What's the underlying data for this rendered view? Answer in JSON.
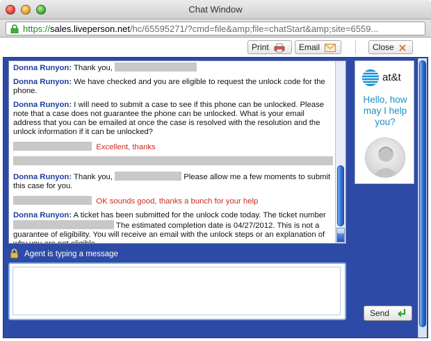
{
  "window": {
    "title": "Chat Window",
    "url_scheme": "https://",
    "url_host": "sales.liveperson.net",
    "url_rest": "/hc/65595271/?cmd=file&amp;file=chatStart&amp;site=6559..."
  },
  "toolbar": {
    "print_label": "Print",
    "email_label": "Email",
    "close_label": "Close"
  },
  "transcript": {
    "speaker": "Donna Runyon:",
    "messages": [
      {
        "text": " Thank you, "
      },
      {
        "text": " We have checked and you are eligible to request the unlock code for the phone."
      },
      {
        "text": " I will need to submit a case to see if this phone can be unlocked.  Please note that a case does not guarantee the phone can be unlocked.  What is your email address that you can be emailed at once the case is resolved with the resolution and the unlock information if it can be unlocked?"
      },
      {
        "text": "Excellent, thanks"
      },
      {
        "pre": " Thank you, ",
        "post": "  Please allow me a few moments to submit this case for you."
      },
      {
        "text": "OK sounds good, thanks a bunch for your help"
      },
      {
        "pre": " A ticket has been submitted for the unlock code today.  The ticket number ",
        "post": "  The estimated completion date is 04/27/2012.  This is not a guarantee of eligibility. You will receive an email with the unlock steps or an explanation of why you are not eligible."
      }
    ]
  },
  "status": {
    "typing": "Agent is typing a message"
  },
  "composer": {
    "send_label": "Send"
  },
  "ad": {
    "brand": "at&t",
    "greeting": "Hello, how may I help you?"
  },
  "colors": {
    "panel_blue": "#2d4ba6",
    "speaker_blue": "#1e3c9f",
    "customer_red": "#cc2a1e",
    "att_blue": "#1d90c8"
  }
}
